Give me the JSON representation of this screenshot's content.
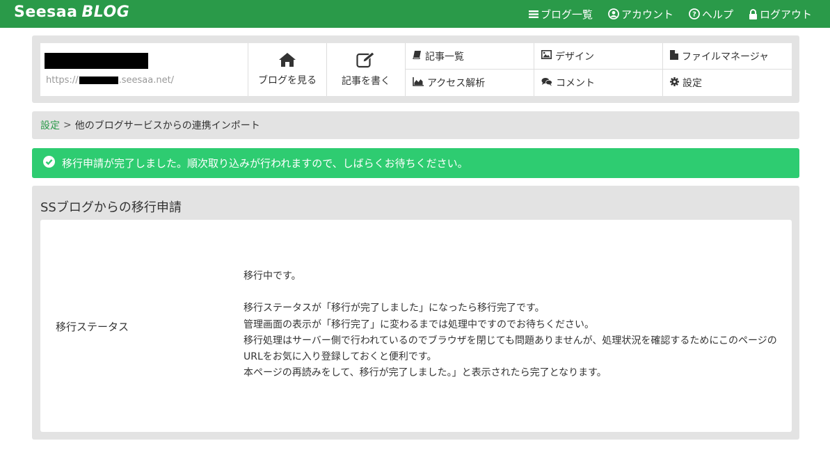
{
  "topbar": {
    "logo_main": "Seesaa",
    "logo_sub": "BLOG",
    "nav": [
      {
        "icon": "list-icon",
        "label": "ブログ一覧"
      },
      {
        "icon": "user-circle-icon",
        "label": "アカウント"
      },
      {
        "icon": "question-circle-icon",
        "label": "ヘルプ"
      },
      {
        "icon": "lock-icon",
        "label": "ログアウト"
      }
    ],
    "color": "#2a9a49"
  },
  "blog": {
    "url_prefix": "https://",
    "url_suffix": ".seesaa.net/"
  },
  "panel": {
    "view_blog": "ブログを見る",
    "write_post": "記事を書く",
    "grid": [
      {
        "icon": "book-icon",
        "label": "記事一覧"
      },
      {
        "icon": "image-icon",
        "label": "デザイン"
      },
      {
        "icon": "file-icon",
        "label": "ファイルマネージャ"
      },
      {
        "icon": "area-chart-icon",
        "label": "アクセス解析"
      },
      {
        "icon": "comments-icon",
        "label": "コメント"
      },
      {
        "icon": "gear-icon",
        "label": "設定"
      }
    ]
  },
  "breadcrumb": {
    "link": "設定",
    "separator": ">",
    "current": "他のブログサービスからの連携インポート"
  },
  "alert": {
    "message": "移行申請が完了しました。順次取り込みが行われますので、しばらくお待ちください。",
    "color": "#2ecc71"
  },
  "main": {
    "title": "SSブログからの移行申請",
    "status_label": "移行ステータス",
    "status_lines": [
      "移行中です。",
      "移行ステータスが「移行が完了しました」になったら移行完了です。",
      "管理画面の表示が「移行完了」に変わるまでは処理中ですのでお待ちください。",
      "移行処理はサーバー側で行われているのでブラウザを閉じても問題ありませんが、処理状況を確認するためにこのページのURLをお気に入り登録しておくと便利です。",
      "本ページの再読みをして、移行が完了しました。」と表示されたら完了となります。"
    ]
  }
}
